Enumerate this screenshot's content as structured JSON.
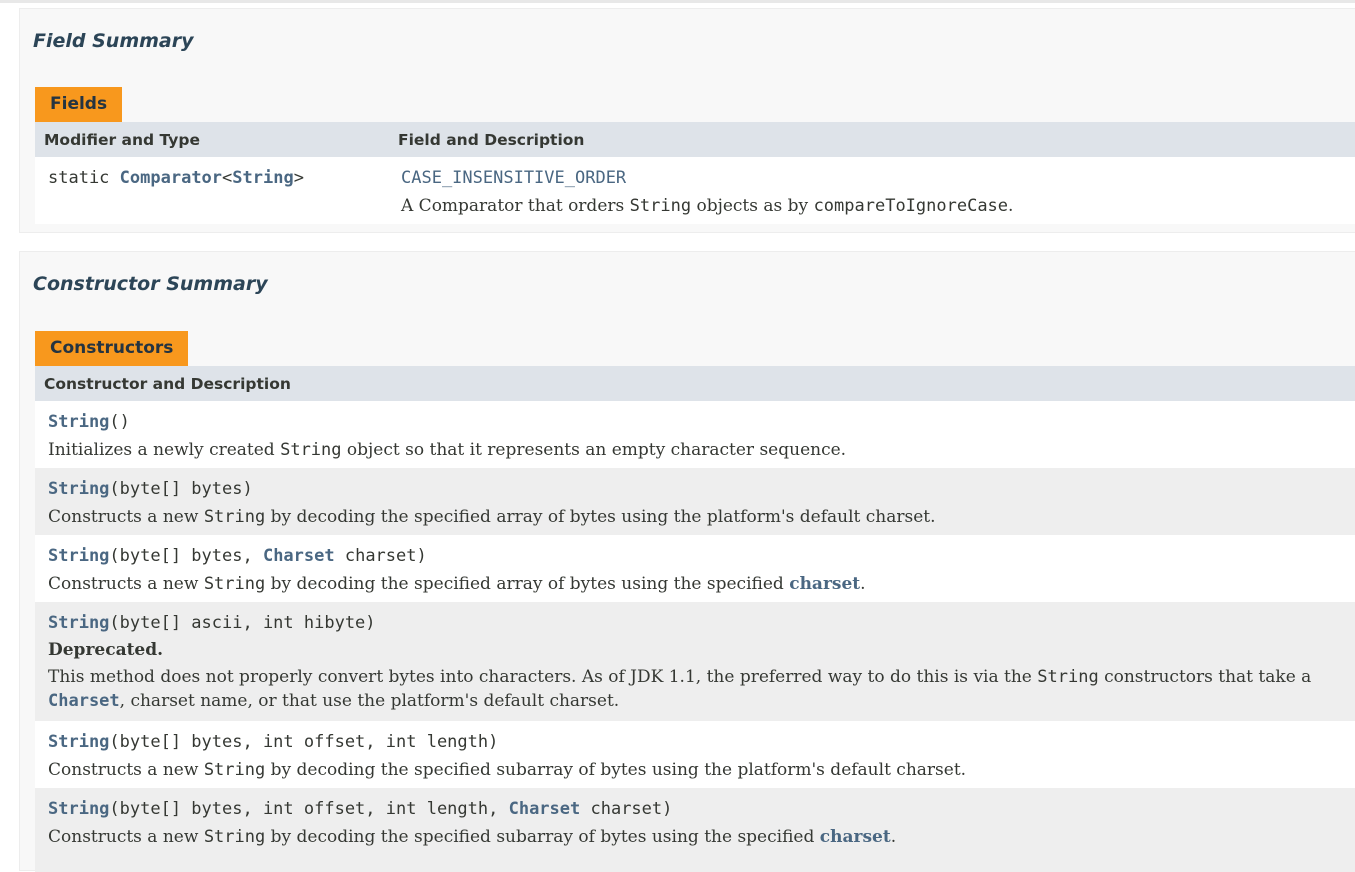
{
  "field_summary": {
    "title": "Field Summary",
    "tab": "Fields",
    "col1": "Modifier and Type",
    "col2": "Field and Description",
    "row": {
      "modifier": "static",
      "type_link": "Comparator",
      "lt": "<",
      "type_arg": "String",
      "gt": ">",
      "name": "CASE_INSENSITIVE_ORDER",
      "desc_pre": "A Comparator that orders ",
      "desc_code1": "String",
      "desc_mid": " objects as by ",
      "desc_code2": "compareToIgnoreCase",
      "desc_post": "."
    }
  },
  "constructor_summary": {
    "title": "Constructor Summary",
    "tab": "Constructors",
    "col1": "Constructor and Description",
    "rows": [
      {
        "name": "String",
        "params": "()",
        "desc_pre": "Initializes a newly created ",
        "desc_code": "String",
        "desc_post": " object so that it represents an empty character sequence."
      },
      {
        "name": "String",
        "params": "(byte[] bytes)",
        "desc_pre": "Constructs a new ",
        "desc_code": "String",
        "desc_post": " by decoding the specified array of bytes using the platform's default charset."
      },
      {
        "name": "String",
        "params_pre": "(byte[] bytes, ",
        "param_link": "Charset",
        "params_post": " charset)",
        "desc_pre": "Constructs a new ",
        "desc_code": "String",
        "desc_mid": " by decoding the specified array of bytes using the specified ",
        "desc_link": "charset",
        "desc_post": "."
      },
      {
        "name": "String",
        "params": "(byte[] ascii, int hibyte)",
        "deprecated": "Deprecated.",
        "desc_pre": "This method does not properly convert bytes into characters. As of JDK 1.1, the preferred way to do this is via the ",
        "desc_code": "String",
        "desc_mid": " constructors that take a ",
        "desc_link": "Charset",
        "desc_post": ", charset name, or that use the platform's default charset."
      },
      {
        "name": "String",
        "params": "(byte[] bytes, int offset, int length)",
        "desc_pre": "Constructs a new ",
        "desc_code": "String",
        "desc_post": " by decoding the specified subarray of bytes using the platform's default charset."
      },
      {
        "name": "String",
        "params_pre": "(byte[] bytes, int offset, int length, ",
        "param_link": "Charset",
        "params_post": " charset)",
        "desc_pre": "Constructs a new ",
        "desc_code": "String",
        "desc_mid": " by decoding the specified subarray of bytes using the specified ",
        "desc_link": "charset",
        "desc_post": "."
      }
    ]
  }
}
